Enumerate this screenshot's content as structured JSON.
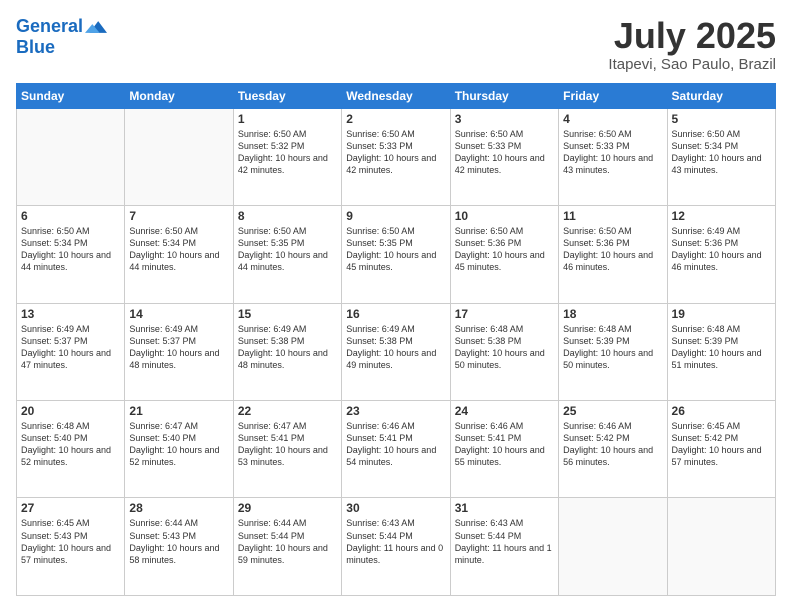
{
  "header": {
    "logo_line1": "General",
    "logo_line2": "Blue",
    "title": "July 2025",
    "subtitle": "Itapevi, Sao Paulo, Brazil"
  },
  "calendar": {
    "days_of_week": [
      "Sunday",
      "Monday",
      "Tuesday",
      "Wednesday",
      "Thursday",
      "Friday",
      "Saturday"
    ],
    "weeks": [
      [
        {
          "day": "",
          "info": ""
        },
        {
          "day": "",
          "info": ""
        },
        {
          "day": "1",
          "info": "Sunrise: 6:50 AM\nSunset: 5:32 PM\nDaylight: 10 hours and 42 minutes."
        },
        {
          "day": "2",
          "info": "Sunrise: 6:50 AM\nSunset: 5:33 PM\nDaylight: 10 hours and 42 minutes."
        },
        {
          "day": "3",
          "info": "Sunrise: 6:50 AM\nSunset: 5:33 PM\nDaylight: 10 hours and 42 minutes."
        },
        {
          "day": "4",
          "info": "Sunrise: 6:50 AM\nSunset: 5:33 PM\nDaylight: 10 hours and 43 minutes."
        },
        {
          "day": "5",
          "info": "Sunrise: 6:50 AM\nSunset: 5:34 PM\nDaylight: 10 hours and 43 minutes."
        }
      ],
      [
        {
          "day": "6",
          "info": "Sunrise: 6:50 AM\nSunset: 5:34 PM\nDaylight: 10 hours and 44 minutes."
        },
        {
          "day": "7",
          "info": "Sunrise: 6:50 AM\nSunset: 5:34 PM\nDaylight: 10 hours and 44 minutes."
        },
        {
          "day": "8",
          "info": "Sunrise: 6:50 AM\nSunset: 5:35 PM\nDaylight: 10 hours and 44 minutes."
        },
        {
          "day": "9",
          "info": "Sunrise: 6:50 AM\nSunset: 5:35 PM\nDaylight: 10 hours and 45 minutes."
        },
        {
          "day": "10",
          "info": "Sunrise: 6:50 AM\nSunset: 5:36 PM\nDaylight: 10 hours and 45 minutes."
        },
        {
          "day": "11",
          "info": "Sunrise: 6:50 AM\nSunset: 5:36 PM\nDaylight: 10 hours and 46 minutes."
        },
        {
          "day": "12",
          "info": "Sunrise: 6:49 AM\nSunset: 5:36 PM\nDaylight: 10 hours and 46 minutes."
        }
      ],
      [
        {
          "day": "13",
          "info": "Sunrise: 6:49 AM\nSunset: 5:37 PM\nDaylight: 10 hours and 47 minutes."
        },
        {
          "day": "14",
          "info": "Sunrise: 6:49 AM\nSunset: 5:37 PM\nDaylight: 10 hours and 48 minutes."
        },
        {
          "day": "15",
          "info": "Sunrise: 6:49 AM\nSunset: 5:38 PM\nDaylight: 10 hours and 48 minutes."
        },
        {
          "day": "16",
          "info": "Sunrise: 6:49 AM\nSunset: 5:38 PM\nDaylight: 10 hours and 49 minutes."
        },
        {
          "day": "17",
          "info": "Sunrise: 6:48 AM\nSunset: 5:38 PM\nDaylight: 10 hours and 50 minutes."
        },
        {
          "day": "18",
          "info": "Sunrise: 6:48 AM\nSunset: 5:39 PM\nDaylight: 10 hours and 50 minutes."
        },
        {
          "day": "19",
          "info": "Sunrise: 6:48 AM\nSunset: 5:39 PM\nDaylight: 10 hours and 51 minutes."
        }
      ],
      [
        {
          "day": "20",
          "info": "Sunrise: 6:48 AM\nSunset: 5:40 PM\nDaylight: 10 hours and 52 minutes."
        },
        {
          "day": "21",
          "info": "Sunrise: 6:47 AM\nSunset: 5:40 PM\nDaylight: 10 hours and 52 minutes."
        },
        {
          "day": "22",
          "info": "Sunrise: 6:47 AM\nSunset: 5:41 PM\nDaylight: 10 hours and 53 minutes."
        },
        {
          "day": "23",
          "info": "Sunrise: 6:46 AM\nSunset: 5:41 PM\nDaylight: 10 hours and 54 minutes."
        },
        {
          "day": "24",
          "info": "Sunrise: 6:46 AM\nSunset: 5:41 PM\nDaylight: 10 hours and 55 minutes."
        },
        {
          "day": "25",
          "info": "Sunrise: 6:46 AM\nSunset: 5:42 PM\nDaylight: 10 hours and 56 minutes."
        },
        {
          "day": "26",
          "info": "Sunrise: 6:45 AM\nSunset: 5:42 PM\nDaylight: 10 hours and 57 minutes."
        }
      ],
      [
        {
          "day": "27",
          "info": "Sunrise: 6:45 AM\nSunset: 5:43 PM\nDaylight: 10 hours and 57 minutes."
        },
        {
          "day": "28",
          "info": "Sunrise: 6:44 AM\nSunset: 5:43 PM\nDaylight: 10 hours and 58 minutes."
        },
        {
          "day": "29",
          "info": "Sunrise: 6:44 AM\nSunset: 5:44 PM\nDaylight: 10 hours and 59 minutes."
        },
        {
          "day": "30",
          "info": "Sunrise: 6:43 AM\nSunset: 5:44 PM\nDaylight: 11 hours and 0 minutes."
        },
        {
          "day": "31",
          "info": "Sunrise: 6:43 AM\nSunset: 5:44 PM\nDaylight: 11 hours and 1 minute."
        },
        {
          "day": "",
          "info": ""
        },
        {
          "day": "",
          "info": ""
        }
      ]
    ]
  }
}
